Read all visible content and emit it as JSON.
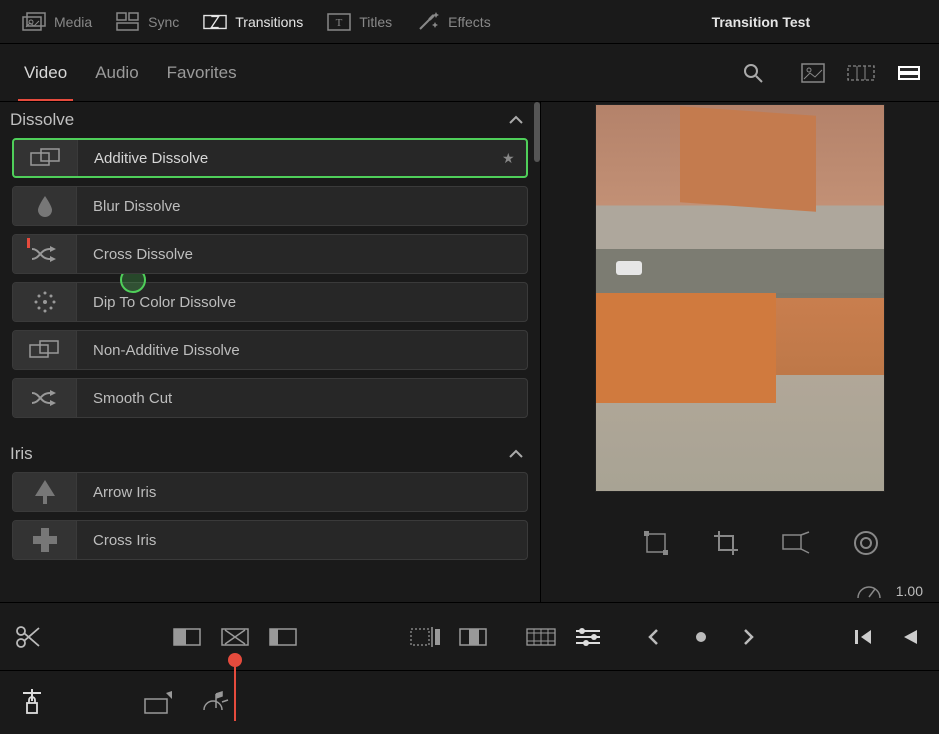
{
  "project_title": "Transition Test",
  "top_nav": {
    "media": "Media",
    "sync": "Sync",
    "transitions": "Transitions",
    "titles": "Titles",
    "effects": "Effects"
  },
  "tabs": {
    "video": "Video",
    "audio": "Audio",
    "favorites": "Favorites"
  },
  "categories": [
    {
      "name": "Dissolve",
      "items": [
        {
          "label": "Additive Dissolve",
          "icon": "overlap-icon",
          "selected": true,
          "favorite": true
        },
        {
          "label": "Blur Dissolve",
          "icon": "drop-icon"
        },
        {
          "label": "Cross Dissolve",
          "icon": "shuffle-icon",
          "red_mark": true
        },
        {
          "label": "Dip To Color Dissolve",
          "icon": "radial-dots-icon"
        },
        {
          "label": "Non-Additive Dissolve",
          "icon": "overlap-icon"
        },
        {
          "label": "Smooth Cut",
          "icon": "shuffle-icon"
        }
      ]
    },
    {
      "name": "Iris",
      "items": [
        {
          "label": "Arrow Iris",
          "icon": "arrow-up-icon"
        },
        {
          "label": "Cross Iris",
          "icon": "plus-icon"
        }
      ]
    }
  ],
  "speed": {
    "value": "1.00"
  }
}
